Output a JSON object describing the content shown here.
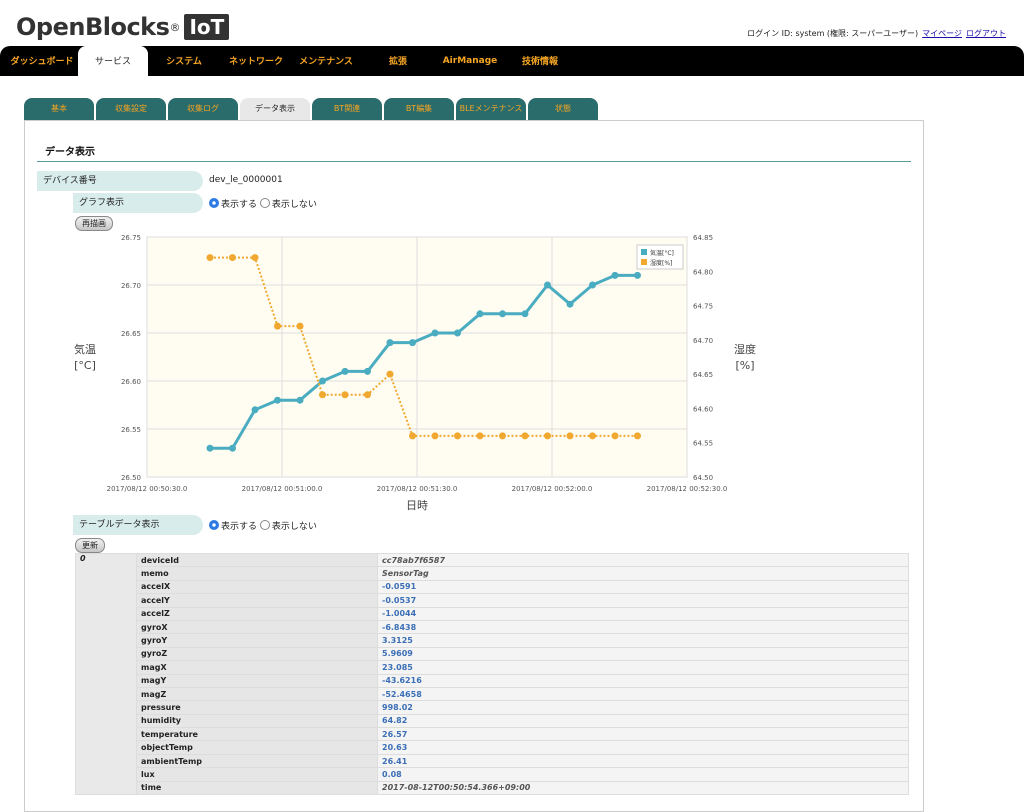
{
  "brand": {
    "name": "OpenBlocks",
    "reg": "®",
    "suffix": "IoT"
  },
  "login": {
    "text": "ログイン ID: system (権限: スーパーユーザー)",
    "mypage": "マイページ",
    "logout": "ログアウト"
  },
  "topnav": [
    {
      "label": "ダッシュボード",
      "active": false
    },
    {
      "label": "サービス",
      "active": true
    },
    {
      "label": "システム",
      "active": false
    },
    {
      "label": "ネットワーク",
      "active": false
    },
    {
      "label": "メンテナンス",
      "active": false
    },
    {
      "label": "拡張",
      "active": false
    },
    {
      "label": "AirManage",
      "active": false
    },
    {
      "label": "技術情報",
      "active": false
    }
  ],
  "subtabs": [
    {
      "label": "基本",
      "active": false
    },
    {
      "label": "収集設定",
      "active": false
    },
    {
      "label": "収集ログ",
      "active": false
    },
    {
      "label": "データ表示",
      "active": true
    },
    {
      "label": "BT関連",
      "active": false
    },
    {
      "label": "BT編集",
      "active": false
    },
    {
      "label": "BLEメンテナンス",
      "active": false
    },
    {
      "label": "状態",
      "active": false
    }
  ],
  "section": {
    "title": "データ表示"
  },
  "device": {
    "label": "デバイス番号",
    "value": "dev_le_0000001"
  },
  "graph_display": {
    "label": "グラフ表示",
    "on_label": "表示する",
    "off_label": "表示しない",
    "selected": "on"
  },
  "redraw_button": "再描画",
  "table_display": {
    "label": "テーブルデータ表示",
    "on_label": "表示する",
    "off_label": "表示しない",
    "selected": "on"
  },
  "update_button": "更新",
  "colors": {
    "temp": "#4aacc0",
    "humid": "#f0a830",
    "nav_text": "#f6a623",
    "subtab_bg": "#2a6b6b"
  },
  "chart_data": {
    "type": "line",
    "xlabel": "日時",
    "y_left_label": [
      "気温",
      "[°C]"
    ],
    "y_right_label": [
      "湿度",
      "[%]"
    ],
    "y_left_ticks": [
      "26.75",
      "26.70",
      "26.65",
      "26.60",
      "26.55",
      "26.50"
    ],
    "y_right_ticks": [
      "64.85",
      "64.80",
      "64.75",
      "64.70",
      "64.65",
      "64.60",
      "64.55",
      "64.50"
    ],
    "y_left_range": [
      26.5,
      26.75
    ],
    "y_right_range": [
      64.5,
      64.85
    ],
    "x_ticks": [
      "2017/08/12 00:50:30.0",
      "2017/08/12 00:51:00.0",
      "2017/08/12 00:51:30.0",
      "2017/08/12 00:52:00.0",
      "2017/08/12 00:52:30.0"
    ],
    "x_range": [
      "2017/08/12 00:50:30",
      "2017/08/12 00:52:30"
    ],
    "legend_position": "top-right",
    "grid": true,
    "series": [
      {
        "name": "気温[°C]",
        "axis": "left",
        "style": "solid",
        "points": [
          [
            "2017/08/12 00:50:44",
            26.53
          ],
          [
            "2017/08/12 00:50:49",
            26.53
          ],
          [
            "2017/08/12 00:50:54",
            26.57
          ],
          [
            "2017/08/12 00:50:59",
            26.58
          ],
          [
            "2017/08/12 00:51:04",
            26.58
          ],
          [
            "2017/08/12 00:51:09",
            26.6
          ],
          [
            "2017/08/12 00:51:14",
            26.61
          ],
          [
            "2017/08/12 00:51:19",
            26.61
          ],
          [
            "2017/08/12 00:51:24",
            26.64
          ],
          [
            "2017/08/12 00:51:29",
            26.64
          ],
          [
            "2017/08/12 00:51:34",
            26.65
          ],
          [
            "2017/08/12 00:51:39",
            26.65
          ],
          [
            "2017/08/12 00:51:44",
            26.67
          ],
          [
            "2017/08/12 00:51:49",
            26.67
          ],
          [
            "2017/08/12 00:51:54",
            26.67
          ],
          [
            "2017/08/12 00:51:59",
            26.7
          ],
          [
            "2017/08/12 00:52:04",
            26.68
          ],
          [
            "2017/08/12 00:52:09",
            26.7
          ],
          [
            "2017/08/12 00:52:14",
            26.71
          ],
          [
            "2017/08/12 00:52:19",
            26.71
          ]
        ]
      },
      {
        "name": "湿度[%]",
        "axis": "right",
        "style": "dotted",
        "points": [
          [
            "2017/08/12 00:50:44",
            64.82
          ],
          [
            "2017/08/12 00:50:49",
            64.82
          ],
          [
            "2017/08/12 00:50:54",
            64.82
          ],
          [
            "2017/08/12 00:50:59",
            64.72
          ],
          [
            "2017/08/12 00:51:04",
            64.72
          ],
          [
            "2017/08/12 00:51:09",
            64.62
          ],
          [
            "2017/08/12 00:51:14",
            64.62
          ],
          [
            "2017/08/12 00:51:19",
            64.62
          ],
          [
            "2017/08/12 00:51:24",
            64.65
          ],
          [
            "2017/08/12 00:51:29",
            64.56
          ],
          [
            "2017/08/12 00:51:34",
            64.56
          ],
          [
            "2017/08/12 00:51:39",
            64.56
          ],
          [
            "2017/08/12 00:51:44",
            64.56
          ],
          [
            "2017/08/12 00:51:49",
            64.56
          ],
          [
            "2017/08/12 00:51:54",
            64.56
          ],
          [
            "2017/08/12 00:51:59",
            64.56
          ],
          [
            "2017/08/12 00:52:04",
            64.56
          ],
          [
            "2017/08/12 00:52:09",
            64.56
          ],
          [
            "2017/08/12 00:52:14",
            64.56
          ],
          [
            "2017/08/12 00:52:19",
            64.56
          ]
        ]
      }
    ]
  },
  "data_table": {
    "index": "0",
    "rows": [
      {
        "key": "deviceId",
        "value": "cc78ab7f6587",
        "kind": "str"
      },
      {
        "key": "memo",
        "value": "SensorTag",
        "kind": "str"
      },
      {
        "key": "accelX",
        "value": "-0.0591",
        "kind": "num"
      },
      {
        "key": "accelY",
        "value": "-0.0537",
        "kind": "num"
      },
      {
        "key": "accelZ",
        "value": "-1.0044",
        "kind": "num"
      },
      {
        "key": "gyroX",
        "value": "-6.8438",
        "kind": "num"
      },
      {
        "key": "gyroY",
        "value": "3.3125",
        "kind": "num"
      },
      {
        "key": "gyroZ",
        "value": "5.9609",
        "kind": "num"
      },
      {
        "key": "magX",
        "value": "23.085",
        "kind": "num"
      },
      {
        "key": "magY",
        "value": "-43.6216",
        "kind": "num"
      },
      {
        "key": "magZ",
        "value": "-52.4658",
        "kind": "num"
      },
      {
        "key": "pressure",
        "value": "998.02",
        "kind": "num"
      },
      {
        "key": "humidity",
        "value": "64.82",
        "kind": "num"
      },
      {
        "key": "temperature",
        "value": "26.57",
        "kind": "num"
      },
      {
        "key": "objectTemp",
        "value": "20.63",
        "kind": "num"
      },
      {
        "key": "ambientTemp",
        "value": "26.41",
        "kind": "num"
      },
      {
        "key": "lux",
        "value": "0.08",
        "kind": "num"
      },
      {
        "key": "time",
        "value": "2017-08-12T00:50:54.366+09:00",
        "kind": "str"
      }
    ]
  }
}
